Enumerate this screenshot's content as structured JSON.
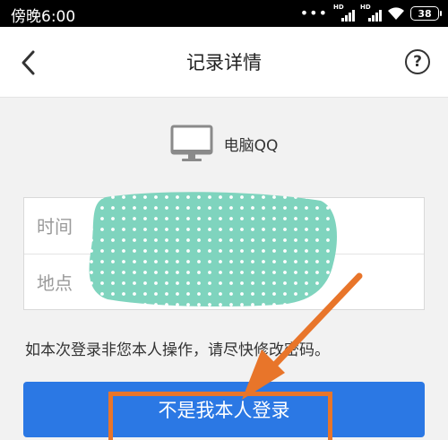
{
  "status_bar": {
    "time": "傍晚6:00",
    "signal_label": "HD",
    "battery": "38"
  },
  "nav": {
    "title": "记录详情",
    "help_glyph": "?"
  },
  "device": {
    "icon": "monitor-icon",
    "name": "电脑QQ"
  },
  "info": {
    "time_label": "时间",
    "location_label": "地点"
  },
  "hint": "如本次登录非您本人操作，请尽快修改密码。",
  "action_button": "不是我本人登录",
  "colors": {
    "primary": "#2b78e4",
    "annotation": "#e8752a",
    "redaction": "#7fd4be"
  }
}
